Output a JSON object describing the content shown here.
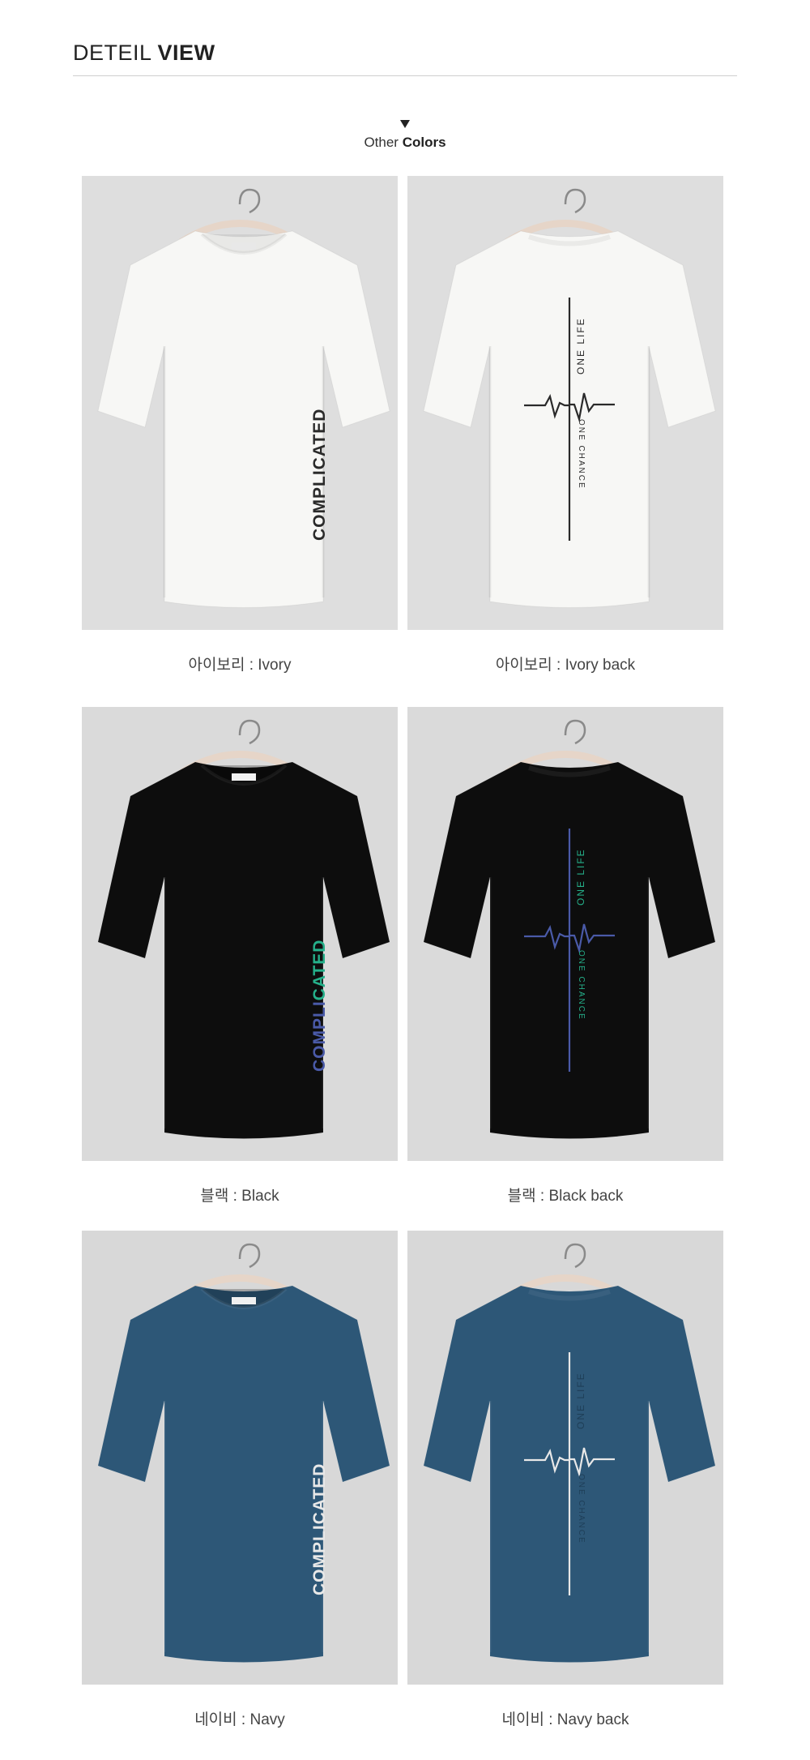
{
  "header": {
    "title_thin": "DETEIL",
    "title_bold": "VIEW"
  },
  "colors_label": {
    "prefix": "Other",
    "bold": "Colors"
  },
  "items": [
    {
      "caption_ko": "아이보리",
      "caption_en": "Ivory",
      "shirt": "#f7f7f5",
      "bg": "#dedede",
      "view": "front",
      "print_text": "COMPLICATED",
      "print_color": "#2a2a2a",
      "print_accent": "#2a2a2a"
    },
    {
      "caption_ko": "아이보리",
      "caption_en": "Ivory back",
      "shirt": "#f7f7f5",
      "bg": "#dedede",
      "view": "back",
      "print_text": "ONE LIFE",
      "print_text2": "ONE CHANCE",
      "print_color": "#2a2a2a",
      "print_accent": "#2a2a2a"
    },
    {
      "caption_ko": "블랙",
      "caption_en": "Black",
      "shirt": "#0d0d0d",
      "bg": "#dadada",
      "view": "front",
      "print_text": "COMPLICATED",
      "print_color": "#4a5aa8",
      "print_accent": "#25b08a"
    },
    {
      "caption_ko": "블랙",
      "caption_en": "Black back",
      "shirt": "#0d0d0d",
      "bg": "#dadada",
      "view": "back",
      "print_text": "ONE LIFE",
      "print_text2": "ONE CHANCE",
      "print_color": "#4a5aa8",
      "print_accent": "#25b08a"
    },
    {
      "caption_ko": "네이비",
      "caption_en": "Navy",
      "shirt": "#2d5777",
      "bg": "#d8d8d8",
      "view": "front",
      "print_text": "COMPLICATED",
      "print_color": "#e8e8e8",
      "print_accent": "#e8e8e8"
    },
    {
      "caption_ko": "네이비",
      "caption_en": "Navy back",
      "shirt": "#2d5777",
      "bg": "#d8d8d8",
      "view": "back",
      "print_text": "ONE LIFE",
      "print_text2": "ONE CHANCE",
      "print_color": "#e8e8e8",
      "print_accent": "#1e3e57"
    }
  ]
}
